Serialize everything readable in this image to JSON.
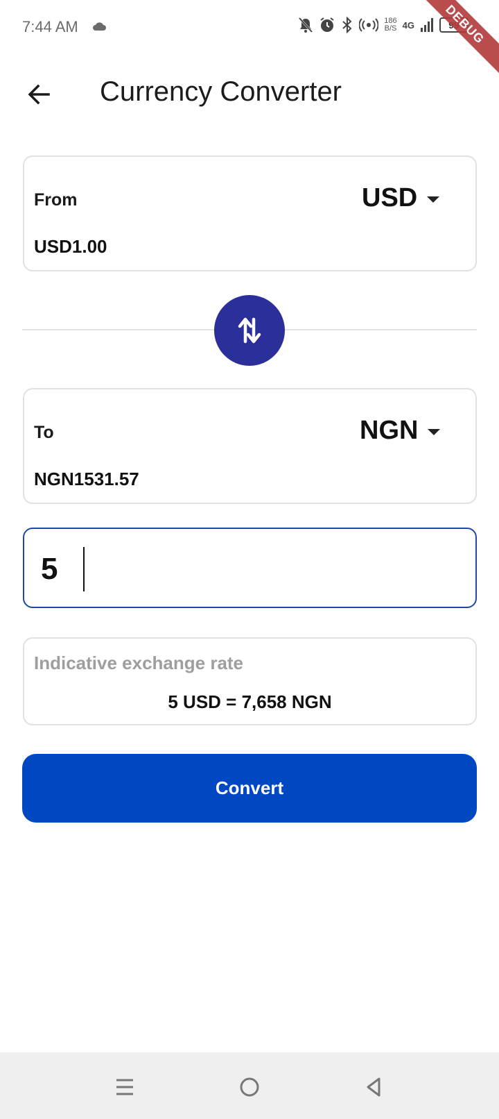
{
  "status_bar": {
    "time": "7:44 AM",
    "net_speed_value": "186",
    "net_speed_unit": "B/S",
    "network": "4G",
    "battery": "99",
    "debug_banner": "DEBUG"
  },
  "app_bar": {
    "title": "Currency Converter",
    "back_icon": "arrow-left-icon"
  },
  "from_card": {
    "label": "From",
    "currency": "USD",
    "value": "USD1.00"
  },
  "swap": {
    "icon": "swap-vertical-icon",
    "color": "#2a2f9a"
  },
  "to_card": {
    "label": "To",
    "currency": "NGN",
    "value": "NGN1531.57"
  },
  "amount": {
    "value": "5"
  },
  "rate_card": {
    "label": "Indicative exchange rate",
    "value": "5 USD = 7,658 NGN"
  },
  "convert_button": {
    "label": "Convert",
    "color": "#0047c2"
  },
  "nav": {
    "recents_icon": "menu-icon",
    "home_icon": "home-circle-icon",
    "back_icon": "back-triangle-icon"
  }
}
